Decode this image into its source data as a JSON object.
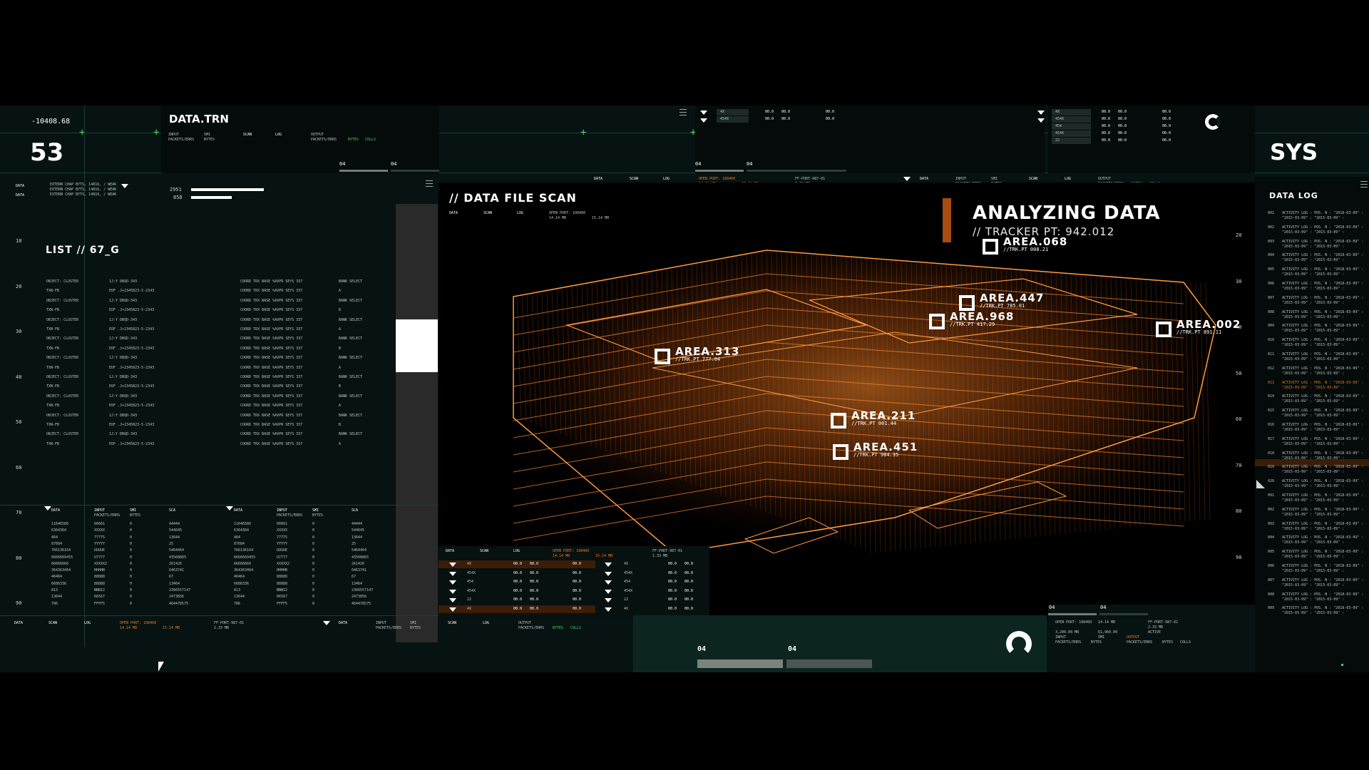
{
  "colors": {
    "accent": "#f07a1c",
    "green": "#49d35a",
    "panel": "#0b1d1b"
  },
  "top": {
    "coord": "-10408.68",
    "count": "53",
    "data_trn": "DATA.TRN",
    "io_labels": [
      "INPUT",
      "SMI",
      "SCAN",
      "LOG",
      "OUTPUT"
    ],
    "io_sub": [
      "PACKETS/ERRS",
      "BYTES",
      "PACKETS/ERRS",
      "BYTES",
      "COLLS"
    ],
    "tabs_a": [
      "04",
      "04"
    ],
    "tabs_b": [
      "04",
      "04"
    ],
    "sys": "SYS"
  },
  "grid_top": {
    "rows_a": [
      {
        "k": "4X",
        "a": "00.0",
        "b": "00.0",
        "c": "00.0"
      },
      {
        "k": "454X",
        "a": "00.0",
        "b": "00.0",
        "c": "00.0"
      }
    ],
    "rows_b": [
      {
        "k": "4X",
        "a": "00.0",
        "b": "00.0",
        "c": "00.0"
      },
      {
        "k": "454X",
        "a": "00.0",
        "b": "00.0",
        "c": "00.0"
      },
      {
        "k": "454",
        "a": "00.0",
        "b": "00.0",
        "c": "00.0"
      },
      {
        "k": "454X",
        "a": "00.0",
        "b": "00.0",
        "c": "00.0"
      },
      {
        "k": "22",
        "a": "00.0",
        "b": "00.0",
        "c": "00.0"
      }
    ]
  },
  "left": {
    "data_label": "DATA",
    "extern_lines": [
      "EXTERN CHAP BYTS, 14816, / WEAK",
      "EXTERN CHAP BYTS, 14816, / WEAK",
      "EXTERN CHAP BYTS, 14816, / WEAK"
    ],
    "bars": [
      {
        "value": "2951",
        "fraction": 1.0
      },
      {
        "value": "858",
        "fraction": 0.56
      }
    ],
    "list_title": "LIST // 67_G",
    "ruler": [
      "10",
      "20",
      "30",
      "40",
      "50",
      "60",
      "70",
      "80",
      "90"
    ],
    "col_a": [
      "OBJECT: CLUSTER",
      "TXN-FB",
      "OBJECT: CLUSTER",
      "TXN-FB",
      "OBJECT: CLUSTER",
      "TXN-FB",
      "OBJECT: CLUSTER",
      "TXN-FB",
      "OBJECT: CLUSTER",
      "TXN-FB",
      "OBJECT: CLUSTER",
      "TXN-FB",
      "OBJECT: CLUSTER",
      "TXN-FB",
      "OBJECT: CLUSTER",
      "TXN-FB",
      "OBJECT: CLUSTER",
      "TXN-FB"
    ],
    "col_b": [
      "1J:Y DBQD-343",
      "EOF .J+2345823-5-2343",
      "1J:Y DBQD-343",
      "EOF .J+2345823-5-2343",
      "1J:Y DBQD-343",
      "EOF .J+2345823-5-2343",
      "1J:Y DBQD-343",
      "EOF .J+2345823-5-2343",
      "1J:Y DBQD-343",
      "EOF .J+2345823-5-2343",
      "1J:Y DBQD-343",
      "EOF .J+2345823-5-2343",
      "1J:Y DBQD-343",
      "EOF .J+2345823-5-2343",
      "1J:Y DBQD-343",
      "EOF .J+2345823-5-2343",
      "1J:Y DBQD-343",
      "EOF .J+2345823-5-2343"
    ],
    "col_c": [
      "COORD TRX BASE %AVPR SEYS 337",
      "COORD TRX BASE %AVPR SEYS 337",
      "COORD TRX BASE %AVPR SEYS 337",
      "COORD TRX BASE %AVPR SEYS 337",
      "COORD TRX BASE %AVPR SEYS 337",
      "COORD TRX BASE %AVPR SEYS 337",
      "COORD TRX BASE %AVPR SEYS 337",
      "COORD TRX BASE %AVPR SEYS 337",
      "COORD TRX BASE %AVPR SEYS 337",
      "COORD TRX BASE %AVPR SEYS 337",
      "COORD TRX BASE %AVPR SEYS 337",
      "COORD TRX BASE %AVPR SEYS 337",
      "COORD TRX BASE %AVPR SEYS 337",
      "COORD TRX BASE %AVPR SEYS 337",
      "COORD TRX BASE %AVPR SEYS 337",
      "COORD TRX BASE %AVPR SEYS 337",
      "COORD TRX BASE %AVPR SEYS 337",
      "COORD TRX BASE %AVPR SEYS 337"
    ],
    "col_d": [
      "BANK SELECT",
      "A",
      "BANK SELECT",
      "B",
      "BANK SELECT",
      "A",
      "BANK SELECT",
      "B",
      "BANK SELECT",
      "A",
      "BANK SELECT",
      "B",
      "BANK SELECT",
      "A",
      "BANK SELECT",
      "B",
      "BANK SELECT",
      "A"
    ],
    "table_hdr": [
      "DATA",
      "INPUT",
      "SMI",
      "SCA"
    ],
    "table_rows": [
      [
        "11646586",
        "66661",
        "0",
        "44444"
      ],
      [
        "6364364",
        "XXXXX",
        "0",
        "544645"
      ],
      [
        "464",
        "77775",
        "0",
        "13644"
      ],
      [
        "87684",
        "YYYYY",
        "0",
        "25"
      ],
      [
        "766136164",
        "UUUUE",
        "0",
        "5464464"
      ],
      [
        "6666669455",
        "U7777",
        "0",
        "43568865"
      ],
      [
        "66666666",
        "XXXXX2",
        "0",
        "261426"
      ],
      [
        "364363464",
        "HHHHB",
        "0",
        "6463741"
      ],
      [
        "46464",
        "88888",
        "0",
        "67"
      ],
      [
        "6686336",
        "88888",
        "0",
        "13464"
      ],
      [
        "813",
        "NNNI2",
        "0",
        "2366557147"
      ],
      [
        "13644",
        "66567",
        "0",
        "2473856"
      ],
      [
        "786",
        "FFFF5",
        "0",
        "464478575"
      ]
    ]
  },
  "scan": {
    "title": "// DATA FILE SCAN",
    "sub": [
      "DATA",
      "SCAN",
      "LOG"
    ],
    "open_port": "OPEN PORT: 108460",
    "sizes": [
      "14.14 MB",
      "15.14 MB"
    ]
  },
  "viz": {
    "title": "ANALYZING DATA",
    "tracker": "// TRACKER PT: 942.012",
    "areas": [
      {
        "name": "AREA.068",
        "sub": "//TRK.PT 008.21"
      },
      {
        "name": "AREA.447",
        "sub": "//TRK.PT 785.01"
      },
      {
        "name": "AREA.968",
        "sub": "//TRK.PT 417.29"
      },
      {
        "name": "AREA.002",
        "sub": "//TRK.PT 891.11"
      },
      {
        "name": "AREA.313",
        "sub": "//TRK.PT 777.04"
      },
      {
        "name": "AREA.211",
        "sub": "//TRK.PT 001.44"
      },
      {
        "name": "AREA.451",
        "sub": "//TRK.PT 984.35"
      }
    ],
    "ruler": [
      "20",
      "30",
      "40",
      "50",
      "60",
      "70",
      "80",
      "90"
    ]
  },
  "bottom": {
    "labels": [
      "DATA",
      "SCAN",
      "LOG"
    ],
    "open_port": "OPEN PORT: 108460",
    "sizes": [
      "14.14 MB",
      "15.14 MB"
    ],
    "port": "FF-PORT-987-01",
    "port_size": "2.33 MB",
    "tabs": [
      "04",
      "04"
    ],
    "stats": [
      "3,200.00 MB",
      "61,960.00",
      "ACTIVE"
    ],
    "output": "OUTPUT"
  },
  "log": {
    "title": "DATA LOG",
    "entry_a": "ACTIVITY LOG : POS. N : \"2018-03-09\" : ",
    "entry_b": "\"2015-03-09\" : \"2015-03-09\" : ",
    "ids": [
      "001",
      "002",
      "003",
      "004",
      "005",
      "006",
      "007",
      "008",
      "009",
      "010",
      "011",
      "012",
      "013",
      "014",
      "015",
      "016",
      "017",
      "018",
      "019",
      "020",
      "001",
      "002",
      "003",
      "004",
      "005",
      "006",
      "007",
      "008",
      "009"
    ]
  }
}
